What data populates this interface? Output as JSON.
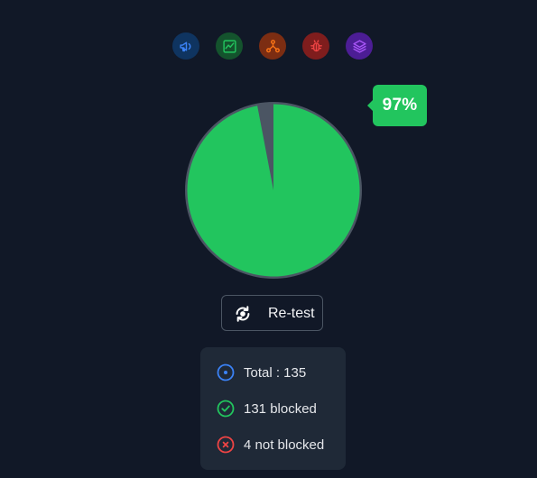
{
  "category_icons": [
    {
      "name": "megaphone-icon",
      "color": "#3b82f6",
      "bg": "#0f3460"
    },
    {
      "name": "chart-icon",
      "color": "#22c55e",
      "bg": "#14532d"
    },
    {
      "name": "network-icon",
      "color": "#f97316",
      "bg": "#7c2d12"
    },
    {
      "name": "bug-icon",
      "color": "#ef4444",
      "bg": "#7f1d1d"
    },
    {
      "name": "layers-icon",
      "color": "#a855f7",
      "bg": "#4c1d95"
    }
  ],
  "result": {
    "percent_label": "97%",
    "blocked_fraction": 0.97,
    "fill_color": "#22c55e",
    "ring_color": "#4b5563"
  },
  "retest": {
    "label": "Re-test",
    "icon": "refresh-icon"
  },
  "stats": {
    "total": "Total : 135",
    "blocked": "131 blocked",
    "not_blocked": "4 not blocked",
    "total_color": "#3b82f6",
    "blocked_color": "#22c55e",
    "not_blocked_color": "#ef4444"
  }
}
